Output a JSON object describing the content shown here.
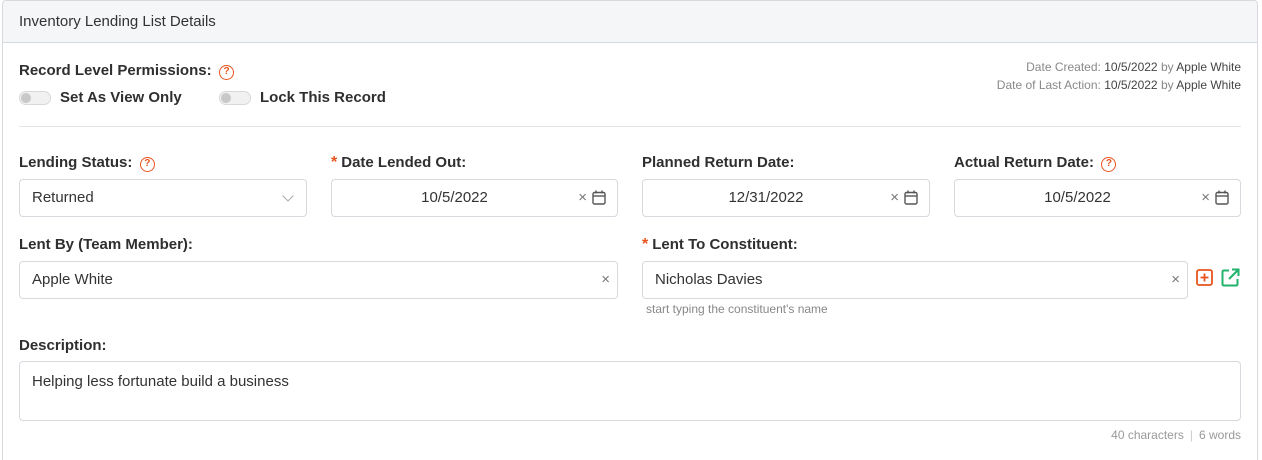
{
  "panel": {
    "title": "Inventory Lending List Details"
  },
  "permissions": {
    "label": "Record Level Permissions:",
    "view_only_label": "Set As View Only",
    "lock_label": "Lock This Record"
  },
  "meta": {
    "created_label": "Date Created:",
    "created_date": "10/5/2022",
    "created_by_word": "by",
    "created_by": "Apple White",
    "last_action_label": "Date of Last Action:",
    "last_action_date": "10/5/2022",
    "last_action_by_word": "by",
    "last_action_by": "Apple White"
  },
  "fields": {
    "lending_status": {
      "label": "Lending Status:",
      "value": "Returned"
    },
    "date_lended_out": {
      "required_mark": "*",
      "label": "Date Lended Out:",
      "value": "10/5/2022"
    },
    "planned_return": {
      "label": "Planned Return Date:",
      "value": "12/31/2022"
    },
    "actual_return": {
      "label": "Actual Return Date:",
      "value": "10/5/2022"
    },
    "lent_by": {
      "label": "Lent By (Team Member):",
      "value": "Apple White"
    },
    "lent_to": {
      "required_mark": "*",
      "label": "Lent To Constituent:",
      "value": "Nicholas Davies",
      "hint": "start typing the constituent's name"
    },
    "description": {
      "label": "Description:",
      "value": "Helping less fortunate build a business",
      "char_count": "40 characters",
      "separator": "|",
      "word_count": "6 words"
    }
  },
  "icons": {
    "help": "?",
    "clear": "×"
  },
  "colors": {
    "accent_orange": "#e8541e",
    "open_green": "#21b36b"
  }
}
